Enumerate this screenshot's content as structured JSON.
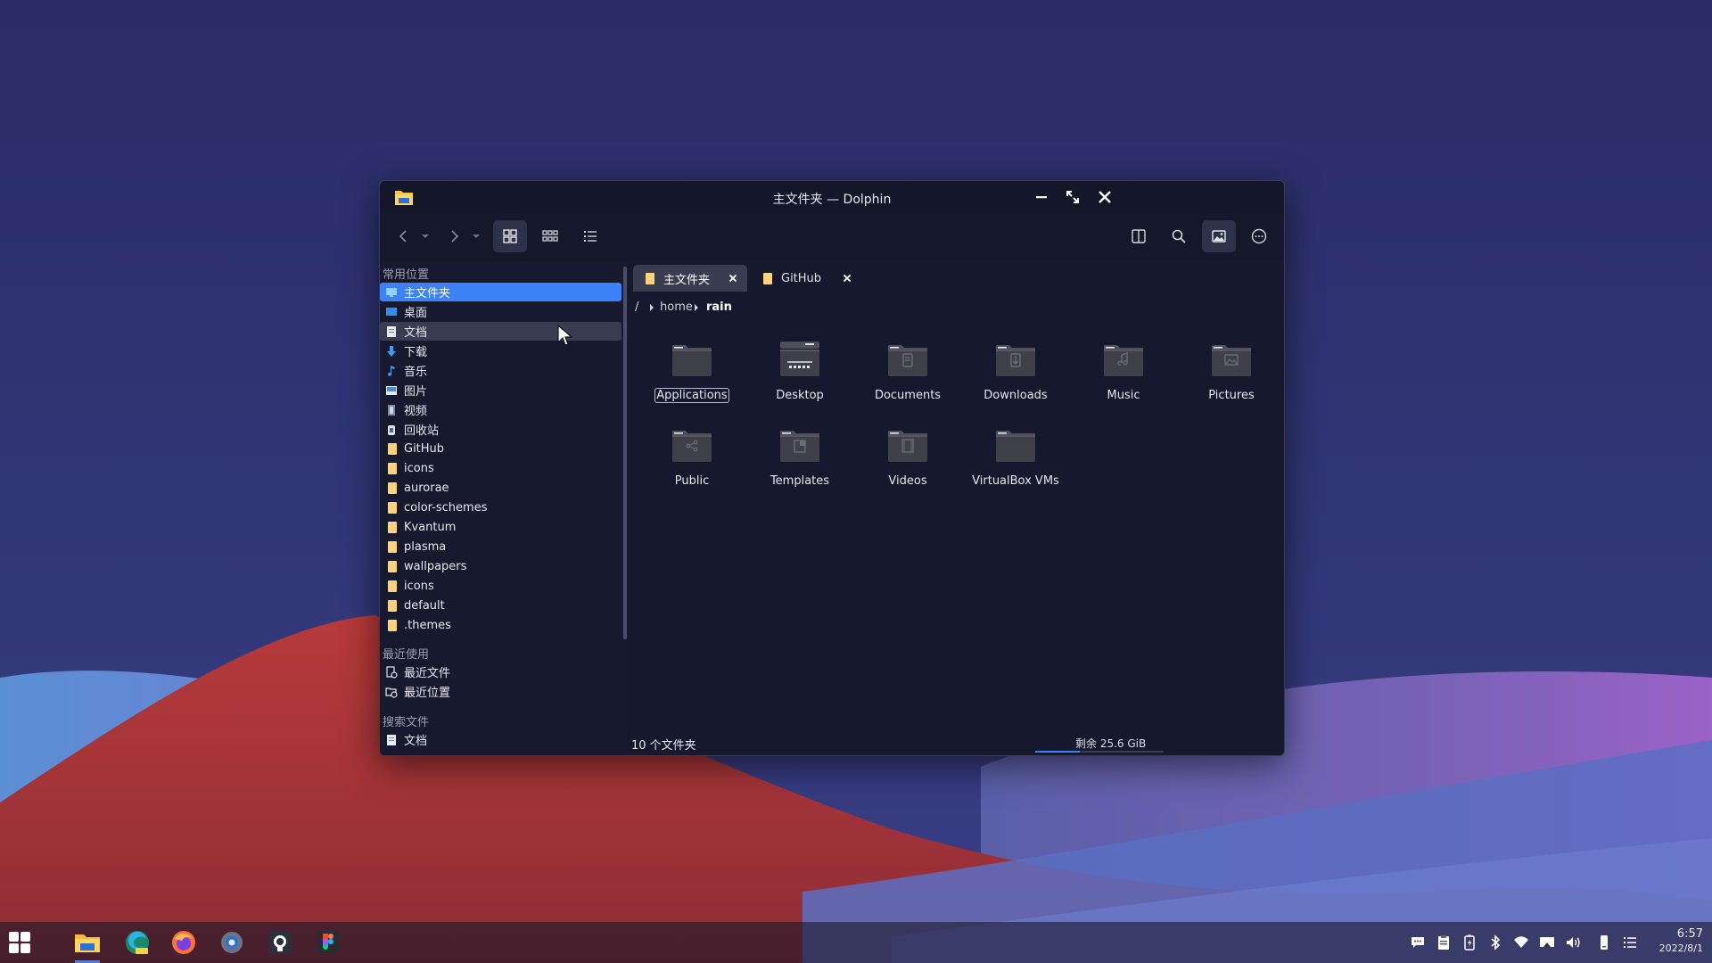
{
  "window": {
    "title": "主文件夹 — Dolphin"
  },
  "sidebar": {
    "sections": {
      "places": "常用位置",
      "recent": "最近使用",
      "search": "搜索文件"
    },
    "places": [
      {
        "label": "主文件夹",
        "icon": "home-icon"
      },
      {
        "label": "桌面",
        "icon": "desktop-icon"
      },
      {
        "label": "文档",
        "icon": "document-icon"
      },
      {
        "label": "下载",
        "icon": "download-icon"
      },
      {
        "label": "音乐",
        "icon": "music-icon"
      },
      {
        "label": "图片",
        "icon": "picture-icon"
      },
      {
        "label": "视频",
        "icon": "video-icon"
      },
      {
        "label": "回收站",
        "icon": "trash-icon"
      },
      {
        "label": "GitHub",
        "icon": "folder-icon"
      },
      {
        "label": "icons",
        "icon": "folder-icon"
      },
      {
        "label": "aurorae",
        "icon": "folder-icon"
      },
      {
        "label": "color-schemes",
        "icon": "folder-icon"
      },
      {
        "label": "Kvantum",
        "icon": "folder-icon"
      },
      {
        "label": "plasma",
        "icon": "folder-icon"
      },
      {
        "label": "wallpapers",
        "icon": "folder-icon"
      },
      {
        "label": "icons",
        "icon": "folder-icon"
      },
      {
        "label": "default",
        "icon": "folder-icon"
      },
      {
        "label": ".themes",
        "icon": "folder-icon"
      }
    ],
    "recent": [
      {
        "label": "最近文件",
        "icon": "recent-files-icon"
      },
      {
        "label": "最近位置",
        "icon": "recent-locations-icon"
      }
    ],
    "search": [
      {
        "label": "文档",
        "icon": "document-icon"
      }
    ]
  },
  "tabs": [
    {
      "label": "主文件夹",
      "active": true
    },
    {
      "label": "GitHub",
      "active": false
    }
  ],
  "breadcrumb": {
    "root": "/",
    "items": [
      "home",
      "rain"
    ]
  },
  "folders": [
    {
      "name": "Applications",
      "emblem": "none"
    },
    {
      "name": "Desktop",
      "emblem": "desktop"
    },
    {
      "name": "Documents",
      "emblem": "document"
    },
    {
      "name": "Downloads",
      "emblem": "download"
    },
    {
      "name": "Music",
      "emblem": "music"
    },
    {
      "name": "Pictures",
      "emblem": "picture"
    },
    {
      "name": "Public",
      "emblem": "share"
    },
    {
      "name": "Templates",
      "emblem": "template"
    },
    {
      "name": "Videos",
      "emblem": "video"
    },
    {
      "name": "VirtualBox VMs",
      "emblem": "none"
    }
  ],
  "status": {
    "count": "10 个文件夹",
    "free_space": "剩余 25.6 GiB",
    "used_fraction": 0.35
  },
  "taskbar": {
    "apps": [
      "start-menu-icon",
      "file-manager-icon",
      "edge-dev-icon",
      "firefox-icon",
      "settings-icon",
      "github-icon",
      "figma-icon"
    ],
    "clock": {
      "time": "6:57",
      "date": "2022/8/1"
    }
  },
  "colors": {
    "accent": "#3b82f6",
    "folder_yellow": "#ffd479",
    "window_bg": "#16192d"
  }
}
